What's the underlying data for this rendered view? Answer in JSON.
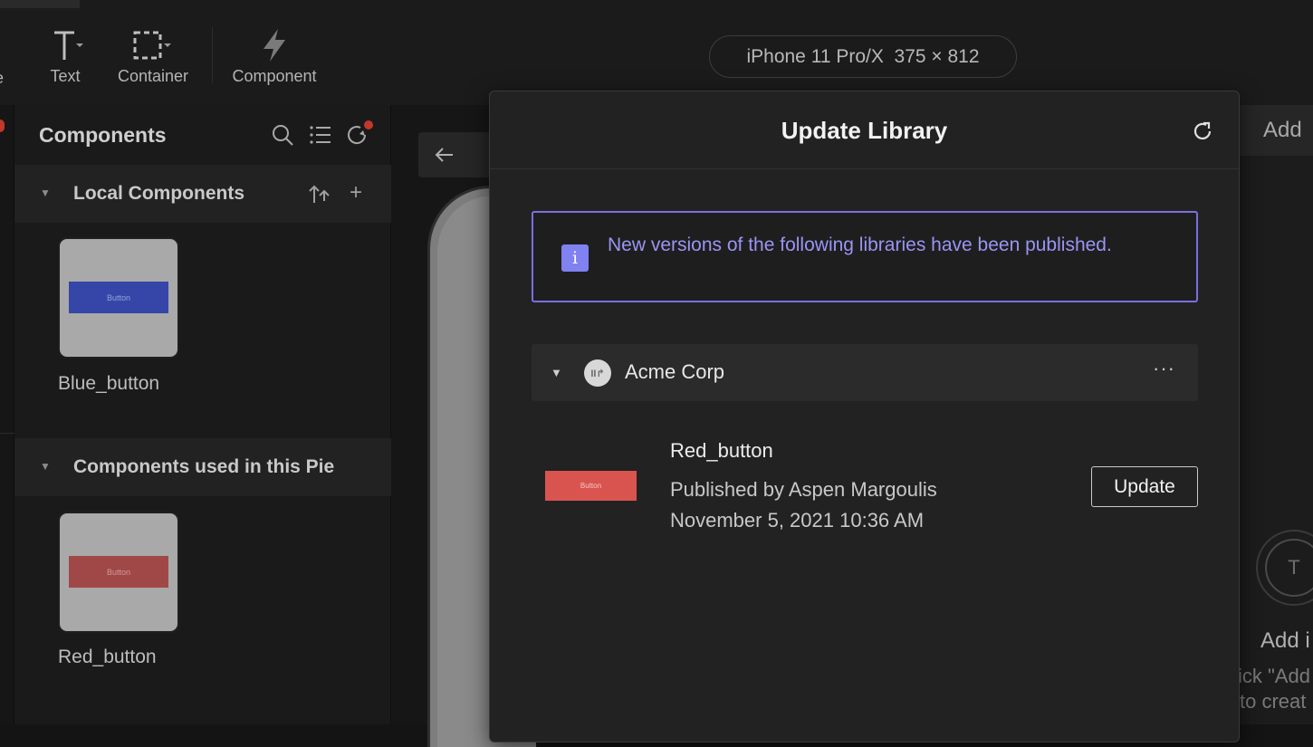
{
  "toolbar": {
    "partial_label": "e",
    "tools": [
      {
        "label": "Text",
        "icon": "text-icon"
      },
      {
        "label": "Container",
        "icon": "container-icon"
      },
      {
        "label": "Component",
        "icon": "lightning-icon"
      }
    ],
    "device": "iPhone 11 Pro/X  375 × 812"
  },
  "components_panel": {
    "title": "Components",
    "icons": [
      "search-icon",
      "list-icon",
      "refresh-notify-icon"
    ],
    "sections": [
      {
        "title": "Local Components",
        "items": [
          {
            "name": "Blue_button",
            "preview_label": "Button",
            "color": "#3546a8"
          }
        ]
      },
      {
        "title": "Components used in this Pie",
        "items": [
          {
            "name": "Red_button",
            "preview_label": "Button",
            "color": "#a04848"
          }
        ]
      }
    ]
  },
  "right_panel": {
    "tab_label": "Add",
    "circle_letter": "T",
    "add_label": "Add i",
    "hint_line1": "ick \"Add",
    "hint_line2": "to creat"
  },
  "modal": {
    "title": "Update Library",
    "info_text": "New versions of the following libraries have been published.",
    "info_icon": "i",
    "library": {
      "name": "Acme Corp",
      "logo_text": "II↱",
      "more": "···",
      "items": [
        {
          "name": "Red_button",
          "thumb_label": "Button",
          "publisher": "Published by Aspen Margoulis",
          "date": "November 5, 2021 10:36 AM",
          "action": "Update"
        }
      ]
    },
    "accent_color": "#7b6fe0"
  }
}
